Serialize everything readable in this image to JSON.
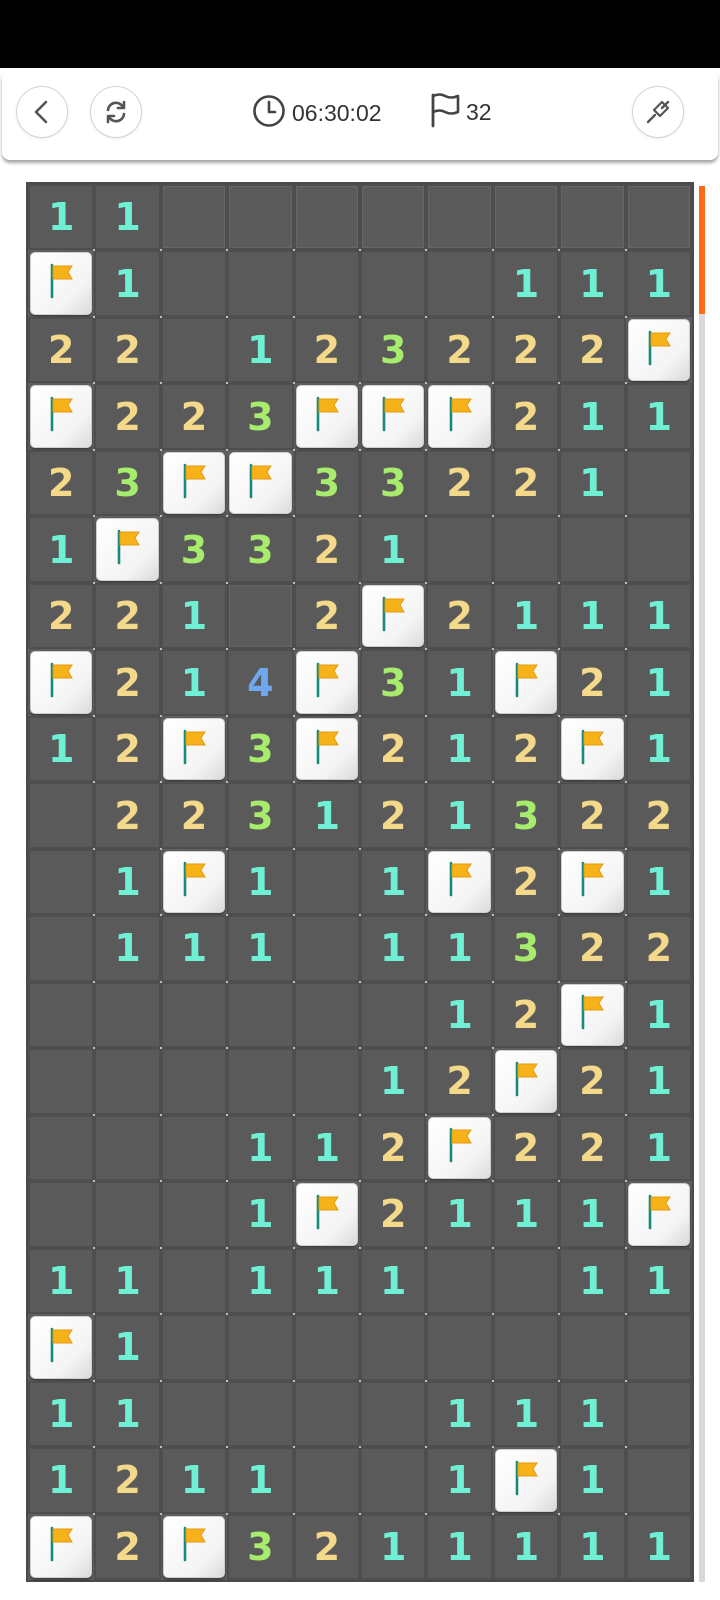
{
  "header": {
    "timer": "06:30:02",
    "flag_count": "32"
  },
  "icons": {
    "back": "chevron-left-icon",
    "restart": "refresh-icon",
    "timer": "clock-icon",
    "flags": "flag-outline-icon",
    "tool": "shovel-icon"
  },
  "colors": {
    "n1": "#6ff0d4",
    "n2": "#f4d98a",
    "n3": "#a7ec6c",
    "n4": "#6fa8f0",
    "scroll_accent": "#ff6a14",
    "flag": "#f7b21a"
  },
  "board": {
    "cols": 10,
    "rows": 21,
    "legend": "digits = revealed number, . = revealed empty, # = covered, F = flag",
    "grid": [
      "11########",
      "F1.....111",
      "22.123222F1",
      "F223FFF211",
      "23FF33221..",
      "1F3321....",
      "221 2F2111.",
      "F214F31F21",
      "12F3F212F1",
      ".2231213222",
      ".1F1.1F2F1",
      ".111.11322",
      "......12F1",
      ".....12F21",
      "...112F221",
      "...1F2111F",
      "11.111..11",
      "F1........",
      "11....111.",
      "1211..1F1.",
      "F2F3211111"
    ]
  }
}
